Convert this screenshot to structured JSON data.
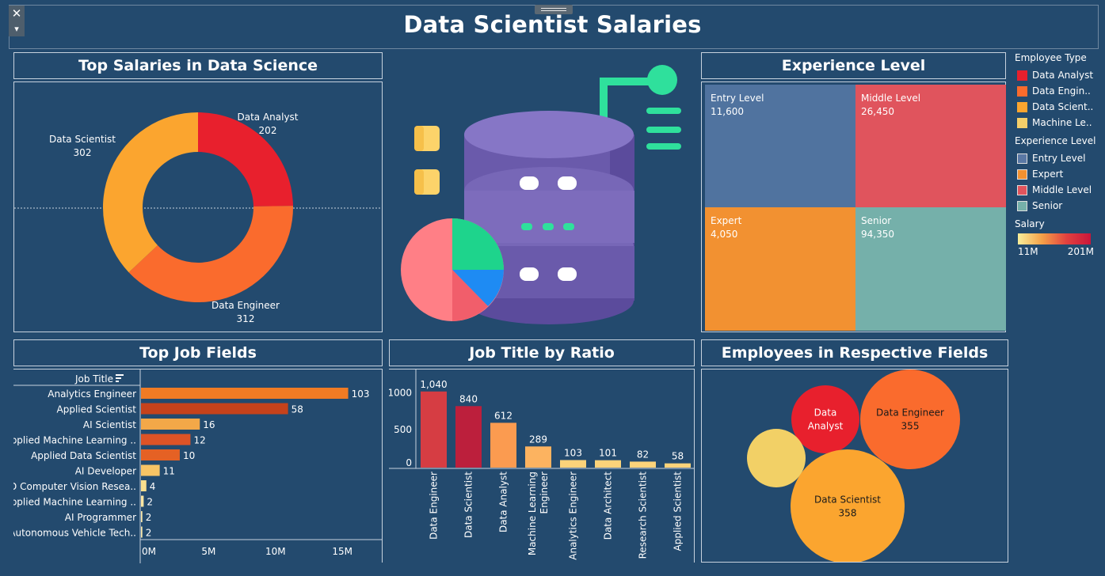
{
  "dashboard": {
    "title": "Data Scientist Salaries",
    "close_glyph": "✕",
    "dropdown_glyph": "▾"
  },
  "panels": {
    "top_salaries": "Top Salaries in Data Science",
    "experience": "Experience Level",
    "job_fields": "Top Job Fields",
    "ratio": "Job Title by Ratio",
    "employees": "Employees in Respective Fields"
  },
  "legend": {
    "employee_type_title": "Employee Type",
    "employee_types": [
      {
        "label": "Data Analyst",
        "color": "#e8202d"
      },
      {
        "label": "Data Engin..",
        "color": "#fa6b2d"
      },
      {
        "label": "Data Scient..",
        "color": "#fba52f"
      },
      {
        "label": "Machine Le..",
        "color": "#f4cf6a"
      }
    ],
    "experience_title": "Experience Level",
    "experience_levels": [
      {
        "label": "Entry Level",
        "color": "#5a78a5"
      },
      {
        "label": "Expert",
        "color": "#f29131"
      },
      {
        "label": "Middle Level",
        "color": "#e0545d"
      },
      {
        "label": "Senior",
        "color": "#75b0aa"
      }
    ],
    "salary_title": "Salary",
    "salary_min": "11M",
    "salary_max": "201M"
  },
  "decor": {
    "illustration": "database-illustration"
  },
  "chart_data": [
    {
      "id": "top_salaries",
      "type": "pie",
      "title": "Top Salaries in Data Science",
      "slices": [
        {
          "label": "Data Analyst",
          "value": 202,
          "value_label": "202",
          "color": "#e8202d"
        },
        {
          "label": "Data Engineer",
          "value": 312,
          "value_label": "312",
          "color": "#fa6b2d"
        },
        {
          "label": "Data Scientist",
          "value": 302,
          "value_label": "302",
          "color": "#fba52f"
        }
      ]
    },
    {
      "id": "experience",
      "type": "heatmap",
      "title": "Experience Level",
      "cells": [
        {
          "label": "Entry Level",
          "value": 11600,
          "value_label": "11,600",
          "color": "#50739f"
        },
        {
          "label": "Middle Level",
          "value": 26450,
          "value_label": "26,450",
          "color": "#e0545d"
        },
        {
          "label": "Expert",
          "value": 4050,
          "value_label": "4,050",
          "color": "#f29131"
        },
        {
          "label": "Senior",
          "value": 94350,
          "value_label": "94,350",
          "color": "#75b0aa"
        }
      ]
    },
    {
      "id": "job_fields",
      "type": "bar",
      "title": "Top Job Fields",
      "column_header": "Job Title",
      "categories": [
        "Analytics Engineer",
        "Applied Scientist",
        "AI Scientist",
        "Applied Machine Learning ..",
        "Applied Data Scientist",
        "AI Developer",
        "3D Computer Vision Resea..",
        "Applied Machine Learning ..",
        "AI Programmer",
        "Autonomous Vehicle Tech.."
      ],
      "values": [
        103,
        58,
        16,
        12,
        10,
        11,
        4,
        2,
        2,
        2
      ],
      "bar_lengths_m": [
        15.5,
        11.0,
        4.4,
        3.7,
        2.9,
        1.4,
        0.4,
        0.2,
        0.1,
        0.1
      ],
      "colors": [
        "#f07b24",
        "#c6421b",
        "#f3a848",
        "#dd5326",
        "#e56124",
        "#f7c465",
        "#f9e08e",
        "#fbe6a2",
        "#fbe9ac",
        "#fbe9ac"
      ],
      "x_ticks": [
        "0M",
        "5M",
        "10M",
        "15M"
      ],
      "xlim": [
        0,
        18
      ]
    },
    {
      "id": "ratio",
      "type": "bar",
      "title": "Job Title by Ratio",
      "categories": [
        "Data Engineer",
        "Data Scientist",
        "Data Analyst",
        "Machine Learning Engineer",
        "Analytics Engineer",
        "Data Architect",
        "Research Scientist",
        "Applied Scientist"
      ],
      "category_lines": [
        [
          "Data Engineer"
        ],
        [
          "Data Scientist"
        ],
        [
          "Data Analyst"
        ],
        [
          "Machine Learning",
          "Engineer"
        ],
        [
          "Analytics Engineer"
        ],
        [
          "Data Architect"
        ],
        [
          "Research Scientist"
        ],
        [
          "Applied Scientist"
        ]
      ],
      "values": [
        1040,
        840,
        612,
        289,
        103,
        101,
        82,
        58
      ],
      "value_labels": [
        "1,040",
        "840",
        "612",
        "289",
        "103",
        "101",
        "82",
        "58"
      ],
      "colors": [
        "#d63d43",
        "#bc1f3c",
        "#fb9b50",
        "#fcb360",
        "#fcd37a",
        "#fcd37a",
        "#fcd37a",
        "#fcd37a"
      ],
      "y_ticks": [
        0,
        500,
        1000
      ],
      "y_tick_labels": [
        "0",
        "500",
        "1000"
      ],
      "ylim": [
        0,
        1150
      ]
    },
    {
      "id": "employees",
      "type": "scatter",
      "title": "Employees in Respective Fields",
      "bubbles": [
        {
          "label": "Data Analyst",
          "label_lines": [
            "Data",
            "Analyst"
          ],
          "value_label": "",
          "color": "#e8202d"
        },
        {
          "label": "Data Engineer",
          "label_lines": [
            "Data Engineer"
          ],
          "value_label": "355",
          "color": "#fa6b2d"
        },
        {
          "label": "Machine Learning Engineer",
          "label_lines": [],
          "value_label": "",
          "color": "#f2d066"
        },
        {
          "label": "Data Scientist",
          "label_lines": [
            "Data Scientist"
          ],
          "value_label": "358",
          "color": "#fba52f"
        }
      ]
    }
  ]
}
